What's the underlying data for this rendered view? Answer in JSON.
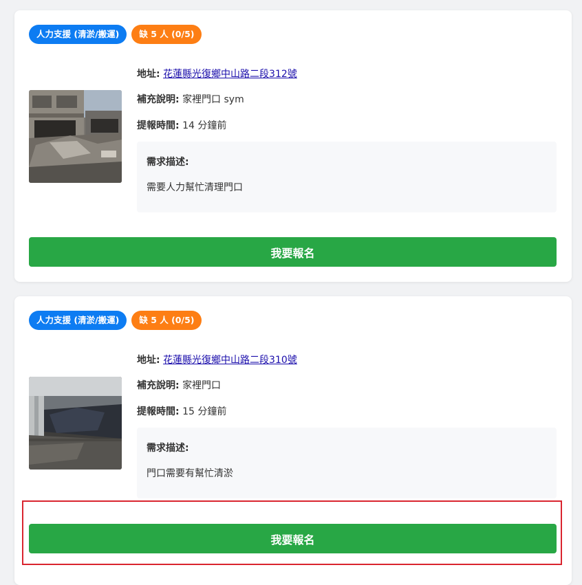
{
  "cards": [
    {
      "category_badge": "人力支援 (清淤/搬運)",
      "shortage_badge": "缺 5 人 (0/5)",
      "address_label": "地址:",
      "address_value": "花蓮縣光復鄉中山路二段312號",
      "note_label": "補充說明:",
      "note_value": "家裡門口 sym",
      "time_label": "提報時間:",
      "time_value": "14 分鐘前",
      "desc_title": "需求描述:",
      "desc_text": "需要人力幫忙清理門口",
      "signup_label": "我要報名"
    },
    {
      "category_badge": "人力支援 (清淤/搬運)",
      "shortage_badge": "缺 5 人 (0/5)",
      "address_label": "地址:",
      "address_value": "花蓮縣光復鄉中山路二段310號",
      "note_label": "補充說明:",
      "note_value": "家裡門口",
      "time_label": "提報時間:",
      "time_value": "15 分鐘前",
      "desc_title": "需求描述:",
      "desc_text": "門口需要有幫忙清淤",
      "signup_label": "我要報名"
    }
  ],
  "colors": {
    "category_badge": "#0d7cf2",
    "shortage_badge": "#fd7e14",
    "signup_button": "#28a745",
    "highlight_outline": "#d9242e",
    "link": "#1a0dab"
  }
}
